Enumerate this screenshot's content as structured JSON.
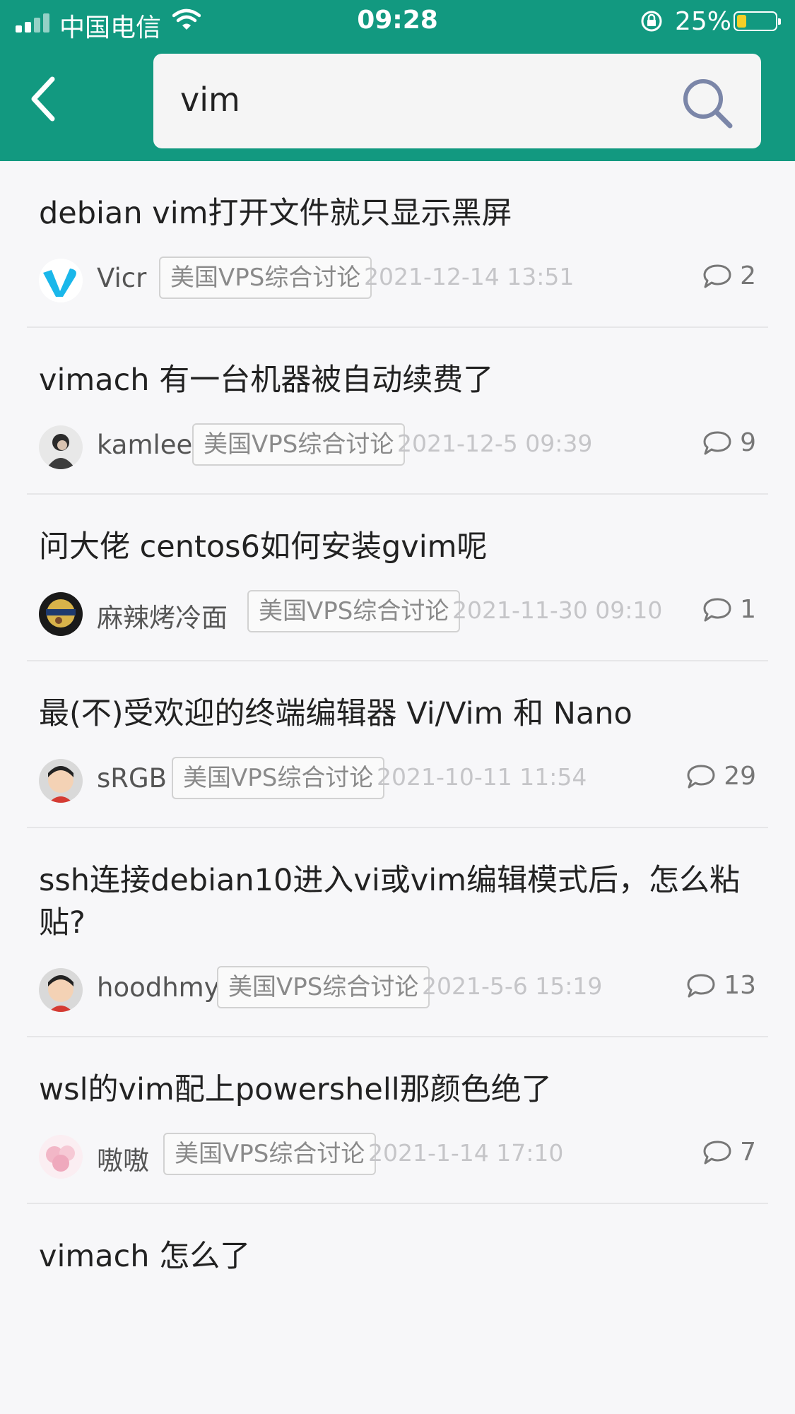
{
  "status_bar": {
    "carrier": "中国电信",
    "time": "09:28",
    "battery": "25%",
    "battery_level": 0.25,
    "icons": [
      "signal-icon",
      "wifi-icon",
      "rotation-lock-icon",
      "battery-icon"
    ]
  },
  "header": {
    "back_icon": "chevron-left-icon",
    "search_value": "vim",
    "search_icon": "search-icon",
    "accent_color": "#129980"
  },
  "results": [
    {
      "title": "debian vim打开文件就只显示黑屏",
      "author": "Vicr",
      "tag": "美国VPS综合讨论",
      "date": "2021-12-14 13:51",
      "comments": "2"
    },
    {
      "title": "vimach 有一台机器被自动续费了",
      "author": "kamlee",
      "tag": "美国VPS综合讨论",
      "date": "2021-12-5 09:39",
      "comments": "9"
    },
    {
      "title": "问大佬 centos6如何安装gvim呢",
      "author": "麻辣烤冷面",
      "tag": "美国VPS综合讨论",
      "date": "2021-11-30 09:10",
      "comments": "1"
    },
    {
      "title": "最(不)受欢迎的终端编辑器 Vi/Vim 和 Nano",
      "author": "sRGB",
      "tag": "美国VPS综合讨论",
      "date": "2021-10-11 11:54",
      "comments": "29"
    },
    {
      "title": "ssh连接debian10进入vi或vim编辑模式后，怎么粘贴?",
      "author": "hoodhmy",
      "tag": "美国VPS综合讨论",
      "date": "2021-5-6 15:19",
      "comments": "13"
    },
    {
      "title": "wsl的vim配上powershell那颜色绝了",
      "author": "嗷嗷",
      "tag": "美国VPS综合讨论",
      "date": "2021-1-14 17:10",
      "comments": "7"
    },
    {
      "title": "vimach 怎么了",
      "author": "",
      "tag": "",
      "date": "",
      "comments": ""
    }
  ]
}
